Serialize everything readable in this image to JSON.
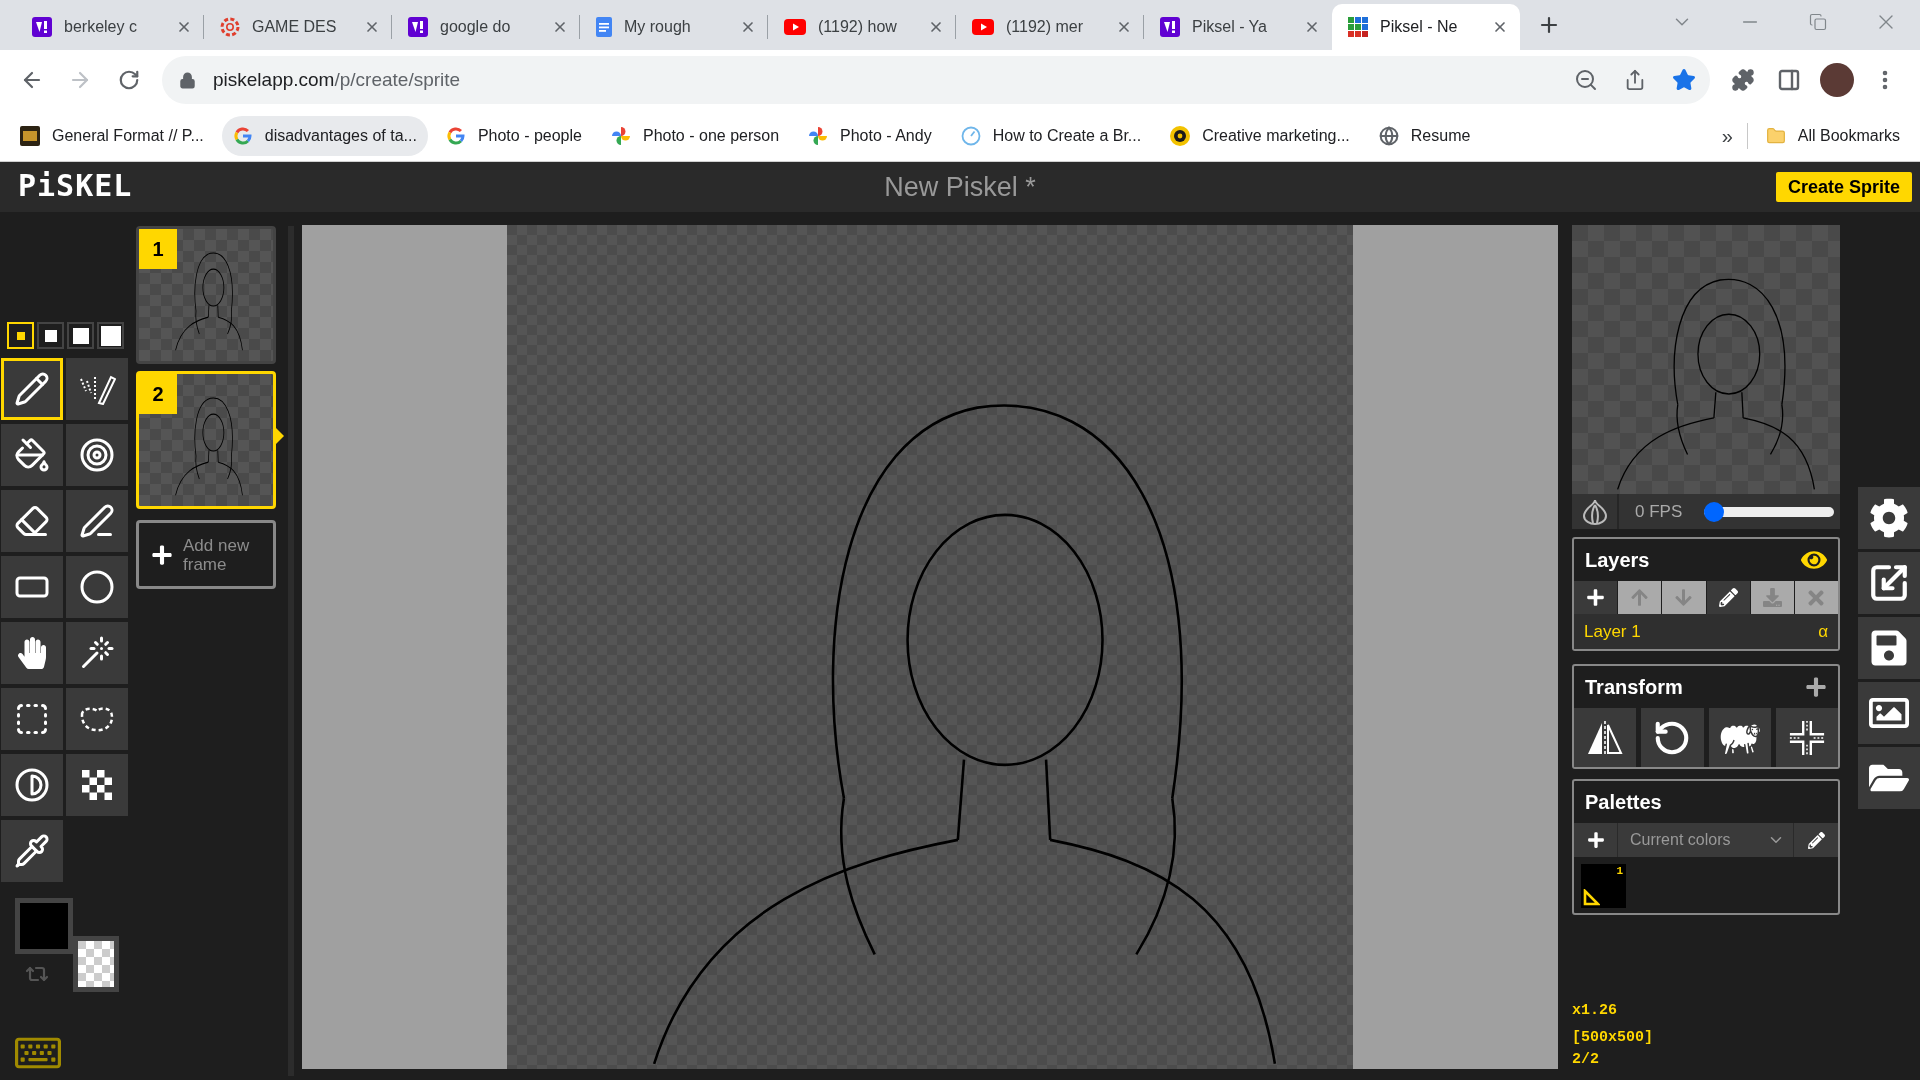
{
  "browser": {
    "tabs": [
      {
        "kind": "y-logo",
        "title": "berkeley c",
        "selected": false
      },
      {
        "kind": "ring-logo",
        "title": "GAME DES",
        "selected": false
      },
      {
        "kind": "y-logo",
        "title": "google do",
        "selected": false
      },
      {
        "kind": "doc-logo",
        "title": "My rough",
        "selected": false
      },
      {
        "kind": "play-logo",
        "title": "(1192) how",
        "selected": false
      },
      {
        "kind": "play-logo",
        "title": "(1192) mer",
        "selected": false
      },
      {
        "kind": "y-logo",
        "title": "Piksel - Ya",
        "selected": false
      },
      {
        "kind": "grid-logo",
        "title": "Piksel - Ne",
        "selected": true
      }
    ],
    "navigation": {
      "back_disabled": false,
      "forward_disabled": true
    },
    "address": {
      "host": "piskelapp.com",
      "path": "/p/create/sprite",
      "bookmarked": true
    },
    "bookmarks": [
      {
        "kind": "cla-logo",
        "label": "General Format // P...",
        "highlighted": false
      },
      {
        "kind": "g-logo",
        "label": "disadvantages of ta...",
        "highlighted": true
      },
      {
        "kind": "g-logo",
        "label": "Photo - people",
        "highlighted": false
      },
      {
        "kind": "pinwheel",
        "label": "Photo - one person",
        "highlighted": false
      },
      {
        "kind": "pinwheel",
        "label": "Photo - Andy",
        "highlighted": false
      },
      {
        "kind": "clock",
        "label": "How to Create a Br...",
        "highlighted": false
      },
      {
        "kind": "emblem",
        "label": "Creative marketing...",
        "highlighted": false
      },
      {
        "kind": "globe",
        "label": "Resume",
        "highlighted": false
      }
    ],
    "bookmarks_overflow": "»",
    "all_bookmarks": "All Bookmarks"
  },
  "piskel": {
    "logo": "PiSKEL",
    "title": "New Piskel *",
    "create_button": "Create Sprite",
    "pen_sizes": [
      {
        "selected": true
      },
      {
        "selected": false
      },
      {
        "selected": false
      },
      {
        "selected": false
      }
    ],
    "tools": [
      {
        "kind": "pen",
        "selected": true
      },
      {
        "kind": "mirror-pen",
        "selected": false
      },
      {
        "kind": "bucket",
        "selected": false
      },
      {
        "kind": "same-color-bucket",
        "selected": false
      },
      {
        "kind": "eraser",
        "selected": false
      },
      {
        "kind": "stroke",
        "selected": false
      },
      {
        "kind": "rectangle",
        "selected": false
      },
      {
        "kind": "ellipse",
        "selected": false
      },
      {
        "kind": "move",
        "selected": false
      },
      {
        "kind": "shape-select",
        "selected": false
      },
      {
        "kind": "rect-select",
        "selected": false
      },
      {
        "kind": "lasso-select",
        "selected": false
      },
      {
        "kind": "lighten",
        "selected": false
      },
      {
        "kind": "dither",
        "selected": false
      },
      {
        "kind": "color-picker",
        "selected": false
      }
    ],
    "color_swatches": [
      {
        "kind": "solid",
        "color": "#000000"
      },
      {
        "kind": "transparent"
      }
    ],
    "frames": [
      {
        "number": "1",
        "selected": false
      },
      {
        "number": "2",
        "selected": true
      }
    ],
    "add_frame": "Add new frame",
    "preview": {
      "fps": "0 FPS",
      "level": 0
    },
    "layers": {
      "title": "Layers",
      "buttons": [
        {
          "kind": "add",
          "disabled": false
        },
        {
          "kind": "up",
          "disabled": true
        },
        {
          "kind": "down",
          "disabled": true
        },
        {
          "kind": "edit",
          "disabled": false
        },
        {
          "kind": "merge",
          "disabled": true
        },
        {
          "kind": "delete",
          "disabled": true
        }
      ],
      "items": [
        {
          "name": "Layer 1",
          "opacity": "α",
          "selected": true
        }
      ]
    },
    "transform": {
      "title": "Transform",
      "tools": [
        {
          "kind": "flip"
        },
        {
          "kind": "rotate"
        },
        {
          "kind": "clone"
        },
        {
          "kind": "center"
        }
      ]
    },
    "palettes": {
      "title": "Palettes",
      "select": "Current colors",
      "colors": [
        {
          "number": "1",
          "color": "#000000",
          "selected": true
        }
      ]
    },
    "status": [
      "x1.26",
      "[500x500]",
      "2/2"
    ],
    "side_tools": [
      {
        "kind": "settings"
      },
      {
        "kind": "resize"
      },
      {
        "kind": "save"
      },
      {
        "kind": "export"
      },
      {
        "kind": "open"
      }
    ]
  }
}
